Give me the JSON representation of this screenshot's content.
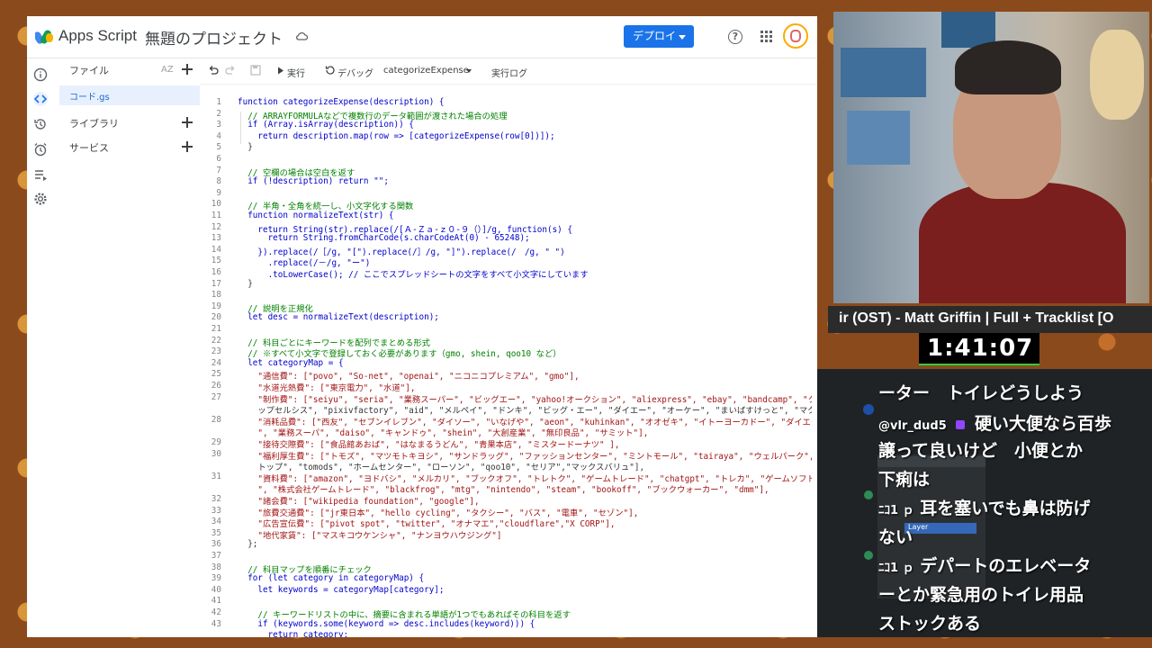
{
  "header": {
    "app_name": "Apps Script",
    "project_title": "無題のプロジェクト",
    "deploy_label": "デプロイ"
  },
  "files_panel": {
    "files_label": "ファイル",
    "sort_label": "AZ",
    "file_name": "コード.gs",
    "libraries_label": "ライブラリ",
    "services_label": "サービス"
  },
  "toolbar": {
    "run_label": "実行",
    "debug_label": "デバッグ",
    "function_select": "categorizeExpense",
    "log_label": "実行ログ"
  },
  "code": {
    "line_numbers": [
      "1",
      "2",
      "3",
      "4",
      "5",
      "6",
      "7",
      "8",
      "9",
      "10",
      "11",
      "12",
      "13",
      "14",
      "15",
      "16",
      "17",
      "18",
      "19",
      "20",
      "21",
      "22",
      "23",
      "24",
      "25",
      "26",
      "27",
      "",
      "28",
      "",
      "29",
      "30",
      "",
      "31",
      "",
      "32",
      "33",
      "34",
      "35",
      "36",
      "37",
      "38",
      "39",
      "40",
      "41",
      "42",
      "43"
    ],
    "lines": [
      "function categorizeExpense(description) {",
      "  // ARRAYFORMULAなどで複数行のデータ範囲が渡された場合の処理",
      "  if (Array.isArray(description)) {",
      "    return description.map(row => [categorizeExpense(row[0])]);",
      "  }",
      "",
      "  // 空欄の場合は空白を返す",
      "  if (!description) return \"\";",
      "",
      "  // 半角・全角を統一し、小文字化する関数",
      "  function normalizeText(str) {",
      "    return String(str).replace(/[Ａ-Ｚａ-ｚ０-９（）]/g, function(s) {",
      "      return String.fromCharCode(s.charCodeAt(0) - 65248);",
      "    }).replace(/［/g, \"[\").replace(/］/g, \"]\").replace(/　/g, \" \")",
      "      .replace(/－/g, \"ー\")",
      "      .toLowerCase(); // ここでスプレッドシートの文字をすべて小文字にしています",
      "  }",
      "",
      "  // 説明を正規化",
      "  let desc = normalizeText(description);",
      "",
      "  // 科目ごとにキーワードを配列でまとめる形式",
      "  // ※すべて小文字で登録しておく必要があります（gmo, shein, qoo10 など）",
      "  let categoryMap = {",
      "    \"通信費\": [\"povo\", \"So-net\", \"openai\", \"ニコニコプレミアム\", \"gmo\"],",
      "    \"水道光熱費\": [\"東京電力\", \"水道\"],",
      "    \"制作費\": [\"seiyu\", \"seria\", \"業務スーパー\", \"ビッグエー\", \"yahoo!オークション\", \"aliexpress\", \"ebay\", \"bandcamp\", \"クリ",
      "    ップセルシス\", \"pixivfactory\", \"aid\", \"メルペイ\", \"ドンキ\", \"ビッグ・エー\", \"ダイエー\", \"オーケー\", \"まいばすけっと\", \"マクド",
      "    \"消耗品費\": [\"西友\", \"セブンイレブン\", \"ダイソー\", \"いなげや\", \"aeon\", \"kuhinkan\", \"オオゼキ\", \"イトーヨーカドー\", \"ダイエー",
      "    \", \"業務スーパ\", \"daiso\", \"キャンドゥ\", \"shein\", \"大創産業\", \"無印良品\", \"サミット\"],",
      "    \"接待交際費\": [\"食品館あおば\", \"はなまるうどん\", \"青果本店\", \"ミスタードーナツ\" ],",
      "    \"福利厚生費\": [\"トモズ\", \"マツモトキヨシ\", \"サンドラッグ\", \"ファッションセンター\", \"ミントモール\", \"tairaya\", \"ウェルパーク\", \"",
      "    トップ\", \"tomods\", \"ホームセンター\", \"ローソン\", \"qoo10\", \"セリア\",\"マックスバリュ\"],",
      "    \"資料費\": [\"amazon\", \"ヨドバシ\", \"メルカリ\", \"ブックオフ\", \"トレトク\", \"ゲームトレード\", \"chatgpt\", \"トレカ\", \"ゲームソフト",
      "    \", \"株式会社ゲームトレード\", \"blackfrog\", \"mtg\", \"nintendo\", \"steam\", \"bookoff\", \"ブックウォーカー\", \"dmm\"],",
      "    \"諸会費\": [\"wikipedia foundation\", \"google\"],",
      "    \"旅費交通費\": [\"jr東日本\", \"hello cycling\", \"タクシー\", \"バス\", \"電車\", \"セゾン\"],",
      "    \"広告宣伝費\": [\"pivot spot\", \"twitter\", \"オナマエ\",\"cloudflare\",\"X CORP\"],",
      "    \"地代家賃\": [\"マスキコウケンシャ\", \"ナンヨウハウジング\"]",
      "  };",
      "",
      "  // 科目マップを順番にチェック",
      "  for (let category in categoryMap) {",
      "    let keywords = categoryMap[category];",
      "",
      "    // キーワードリストの中に、摘要に含まれる単語が1つでもあればその科目を返す",
      "    if (keywords.some(keyword => desc.includes(keyword))) {",
      "      return category;"
    ]
  },
  "stream": {
    "music_title": "ir (OST) - Matt Griffin | Full + Tracklist [O",
    "timer": "1:41:07",
    "chat": [
      {
        "text": "ーター　トイレどうしよう"
      },
      {
        "user": "@vlr_dud5",
        "text": "硬い大便なら百歩"
      },
      {
        "text": "譲って良いけど　小便とか"
      },
      {
        "text": "下痢は"
      },
      {
        "user": "ﾆｺ1 ｐ",
        "text": "耳を塞いでも鼻は防げ"
      },
      {
        "text": "ない"
      },
      {
        "user": "ﾆｺ1 ｐ",
        "text": "デパートのエレベータ"
      },
      {
        "text": "ーとか緊急用のトイレ用品"
      },
      {
        "text": "ストックある"
      }
    ],
    "layer_label": "Layer",
    "gpencil_label": "GPencil"
  },
  "colors": {
    "deploy_blue": "#1a73e8",
    "timer_green": "#2ecc40"
  }
}
